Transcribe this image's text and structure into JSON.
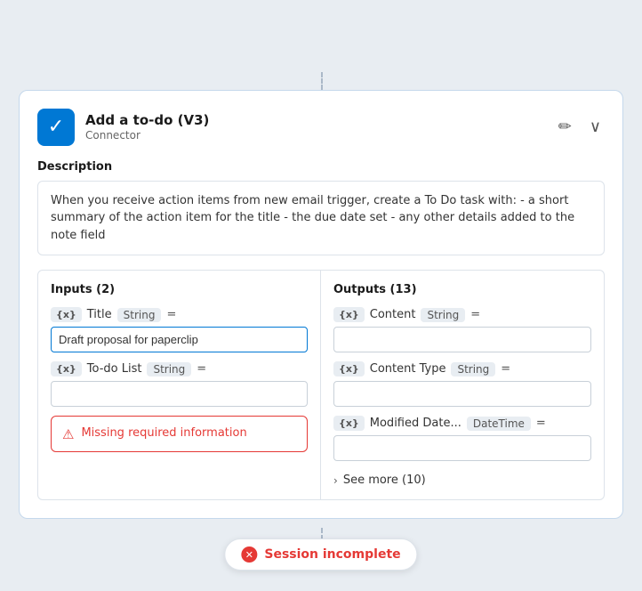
{
  "header": {
    "title": "Add a to-do (V3)",
    "subtitle": "Connector",
    "edit_icon": "✏",
    "expand_icon": "∨"
  },
  "description": {
    "label": "Description",
    "text": "When you receive action items from new email trigger, create a To Do task with: - a short summary of the action item for the title - the due date set - any other details added to the note field"
  },
  "inputs": {
    "title": "Inputs (2)",
    "fields": [
      {
        "tag": "{x}",
        "name": "Title",
        "type": "String",
        "eq": "=",
        "value": "Draft proposal for paperclip",
        "has_value": true
      },
      {
        "tag": "{x}",
        "name": "To-do List",
        "type": "String",
        "eq": "=",
        "value": "",
        "has_value": false
      }
    ],
    "error": {
      "text": "Missing required information"
    }
  },
  "outputs": {
    "title": "Outputs (13)",
    "fields": [
      {
        "tag": "{x}",
        "name": "Content",
        "type": "String",
        "eq": "=",
        "value": ""
      },
      {
        "tag": "{x}",
        "name": "Content Type",
        "type": "String",
        "eq": "=",
        "value": ""
      },
      {
        "tag": "{x}",
        "name": "Modified Date...",
        "type": "DateTime",
        "eq": "=",
        "value": ""
      }
    ],
    "see_more": {
      "label": "See more (10)"
    }
  },
  "session": {
    "text": "Session incomplete"
  }
}
